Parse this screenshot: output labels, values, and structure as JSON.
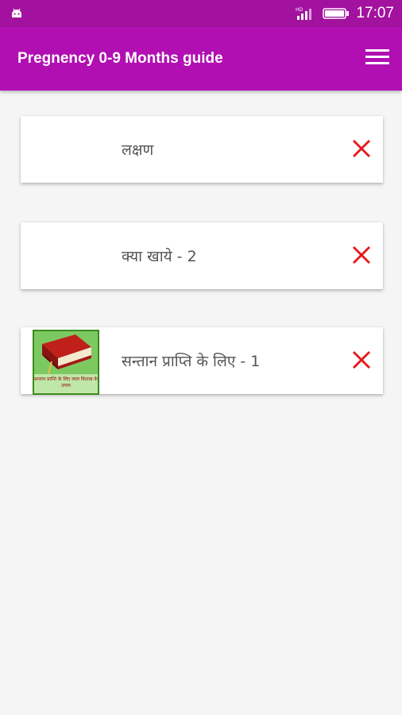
{
  "status": {
    "time": "17:07",
    "left_icon": "android-icon",
    "icons": [
      "signal-icon",
      "battery-icon"
    ]
  },
  "app_bar": {
    "title": "Pregnency 0-9 Months guide",
    "menu_icon": "hamburger-menu-icon"
  },
  "items": [
    {
      "label": "लक्षण",
      "close_icon": "close-icon",
      "has_thumbnail": false
    },
    {
      "label": "क्या खाये - 2",
      "close_icon": "close-icon",
      "has_thumbnail": false
    },
    {
      "label": "सन्तान प्राप्ति के लिए - 1",
      "close_icon": "close-icon",
      "has_thumbnail": true,
      "thumbnail_icon": "book-icon",
      "thumbnail_caption": "सन्तान प्राप्ति के लिए\nलाल किताब के उपाय"
    }
  ],
  "colors": {
    "status_bar": "#a3129f",
    "app_bar": "#b10fb2",
    "close": "#e8161b",
    "background": "#f5f5f5"
  }
}
